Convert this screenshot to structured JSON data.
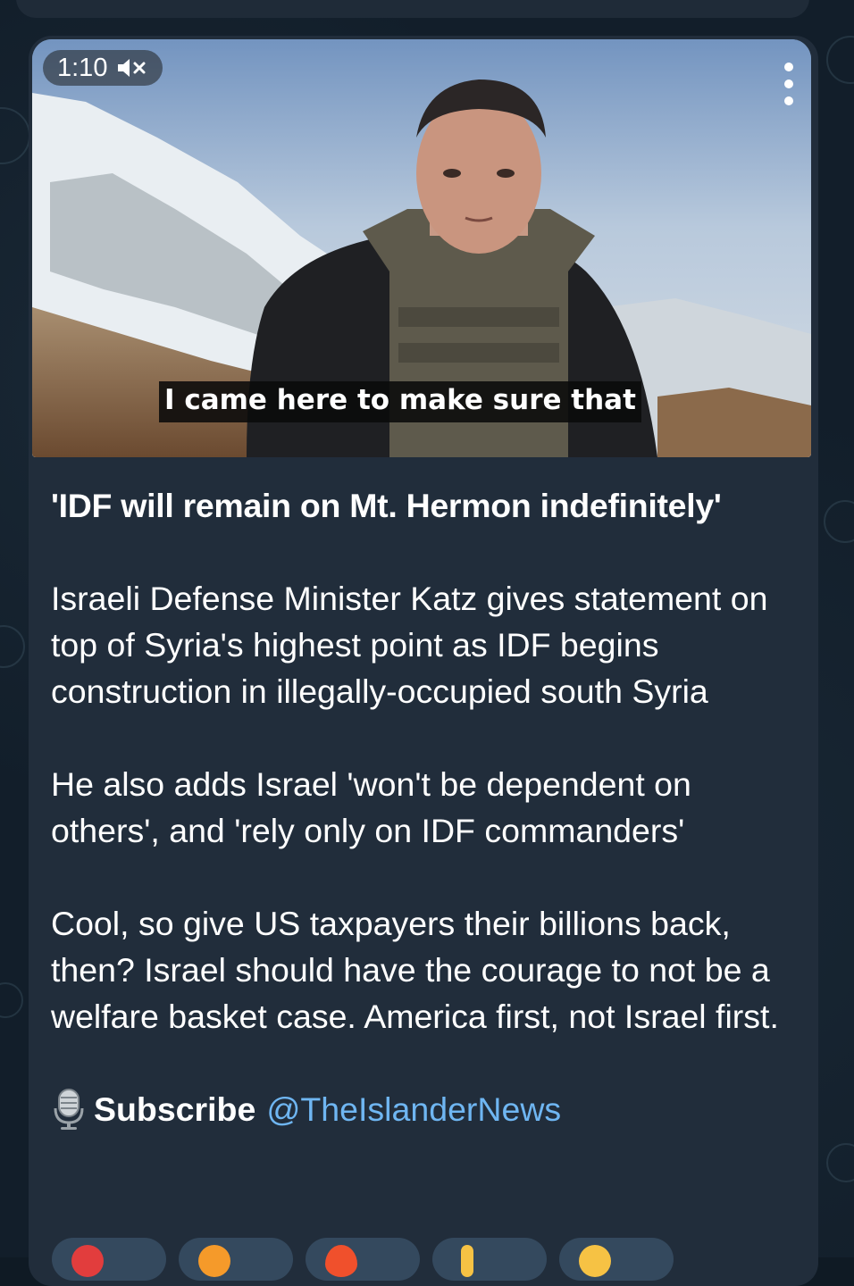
{
  "video": {
    "duration": "1:10",
    "subtitle": "I came here to make sure that",
    "muted": true
  },
  "post": {
    "headline": "'IDF will remain on Mt. Hermon indefinitely'",
    "paragraph1": "Israeli Defense Minister Katz gives statement on top of Syria's highest point as IDF begins construction in illegally-occupied south Syria",
    "paragraph2": "He also adds Israel 'won't be dependent on others', and 'rely only on IDF commanders'",
    "paragraph3": "Cool, so give US taxpayers their billions back, then? Israel should have the courage to not be a welfare basket case. America first, not Israel first."
  },
  "subscribe": {
    "label": "Subscribe",
    "handle": "@TheIslanderNews",
    "icon": "microphone-icon"
  },
  "reactions": [
    {
      "icon": "heart-icon",
      "color": "#e23d3d"
    },
    {
      "icon": "emoji-face-icon",
      "color": "#f59a2a"
    },
    {
      "icon": "fire-icon",
      "color": "#f0502c"
    },
    {
      "icon": "thumbs-up-icon",
      "color": "#f6c244"
    },
    {
      "icon": "smile-icon",
      "color": "#f6c244"
    }
  ],
  "colors": {
    "bubble": "#212d3b",
    "link": "#6fb6f2",
    "background": "#121e2a"
  }
}
